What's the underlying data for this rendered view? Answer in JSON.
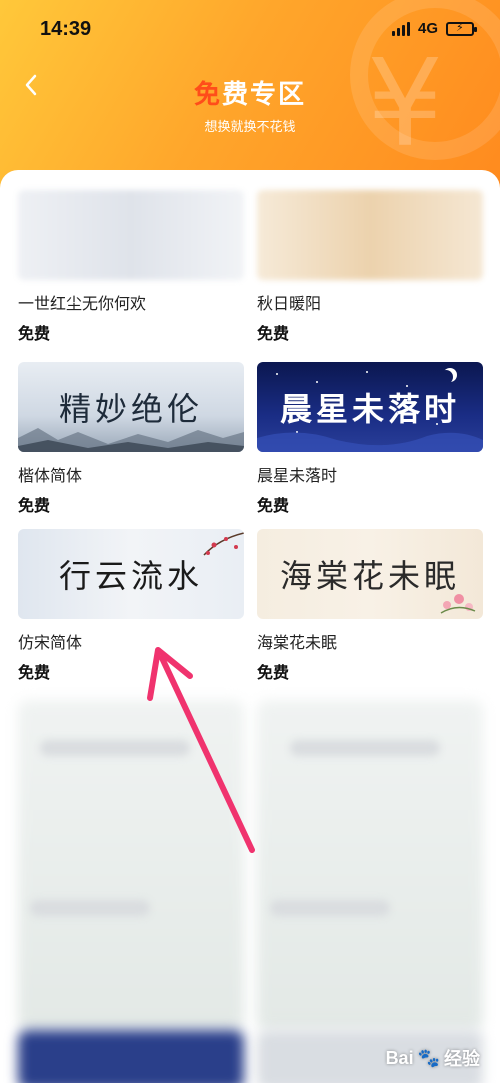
{
  "status_bar": {
    "time": "14:39",
    "network": "4G",
    "battery_level": 0.6
  },
  "header": {
    "title_part1": "免",
    "title_part2": "费专区",
    "subtitle": "想换就换不花钱",
    "back_icon": "chevron-left-icon"
  },
  "fonts": [
    {
      "name": "一世红尘无你何欢",
      "price": "免费",
      "preview": ""
    },
    {
      "name": "秋日暖阳",
      "price": "免费",
      "preview": ""
    },
    {
      "name": "楷体简体",
      "price": "免费",
      "preview": "精妙绝伦"
    },
    {
      "name": "晨星未落时",
      "price": "免费",
      "preview": "晨星未落时"
    },
    {
      "name": "仿宋简体",
      "price": "免费",
      "preview": "行云流水"
    },
    {
      "name": "海棠花未眠",
      "price": "免费",
      "preview": "海棠花未眠"
    }
  ],
  "watermark": {
    "brand": "Bai",
    "brand_suffix": "经验",
    "url": "jingyan.baidu.com"
  },
  "colors": {
    "header_start": "#ffc83a",
    "header_end": "#ff8a1e",
    "title_accent": "#ff4d1a",
    "arrow": "#f0336e"
  }
}
